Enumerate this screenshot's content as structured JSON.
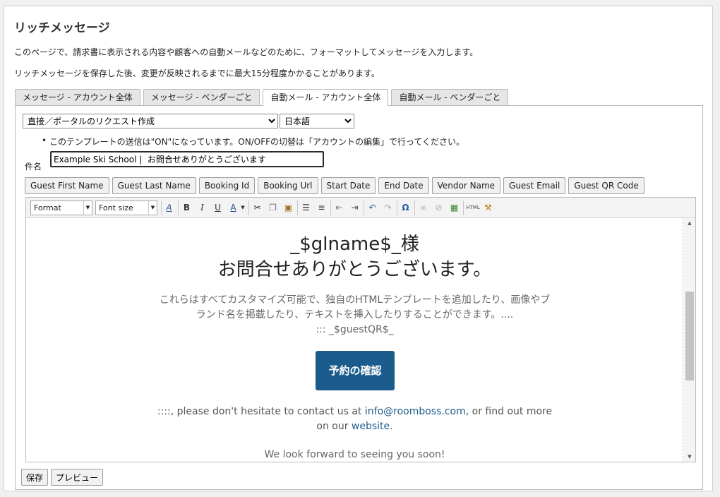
{
  "page": {
    "title": "リッチメッセージ",
    "desc1": "このページで、請求書に表示される内容や顧客への自動メールなどのために、フォーマットしてメッセージを入力します。",
    "desc2": "リッチメッセージを保存した後、変更が反映されるまでに最大15分程度かかることがあります。"
  },
  "tabs": [
    {
      "label": "メッセージ - アカウント全体",
      "active": false
    },
    {
      "label": "メッセージ - ベンダーごと",
      "active": false
    },
    {
      "label": "自動メール - アカウント全体",
      "active": true
    },
    {
      "label": "自動メール - ベンダーごと",
      "active": false
    }
  ],
  "form": {
    "template_select": "直接／ポータルのリクエスト作成",
    "language_select": "日本語",
    "note": "このテンプレートの送信は\"ON\"になっています。ON/OFFの切替は「アカウントの編集」で行ってください。",
    "subject_label": "件名",
    "subject_value": "Example Ski School |  お問合せありがとうございます"
  },
  "placeholders": [
    "Guest First Name",
    "Guest Last Name",
    "Booking Id",
    "Booking Url",
    "Start Date",
    "End Date",
    "Vendor Name",
    "Guest Email",
    "Guest QR Code"
  ],
  "toolbar": {
    "format_label": "Format",
    "fontsize_label": "Font size",
    "icons": [
      "text-color-icon",
      "bold-icon",
      "italic-icon",
      "underline-icon",
      "font-color-icon",
      "cut-icon",
      "copy-icon",
      "paste-icon",
      "bullet-list-icon",
      "numbered-list-icon",
      "outdent-icon",
      "indent-icon",
      "undo-icon",
      "redo-icon",
      "special-char-icon",
      "link-icon",
      "unlink-icon",
      "image-icon",
      "html-icon",
      "clean-icon"
    ]
  },
  "content": {
    "name_line": "_$glname$_様",
    "thanks_line": "お問合せありがとうございます。",
    "body_text": "これらはすべてカスタマイズ可能で、独自のHTMLテンプレートを追加したり、画像やブランド名を掲載したり、テキストを挿入したりすることができます。....",
    "qr_line": "::: _$guestQR$_",
    "button_label": "予約の確認",
    "contact_prefix": "::::, please don't hesitate to contact us at ",
    "contact_email": "info@roomboss.com",
    "contact_mid": ", or find out more on our ",
    "contact_link": "website",
    "contact_suffix": ".",
    "forward": "We look forward to seeing you soon!"
  },
  "footer": {
    "save_label": "保存",
    "preview_label": "プレビュー"
  }
}
